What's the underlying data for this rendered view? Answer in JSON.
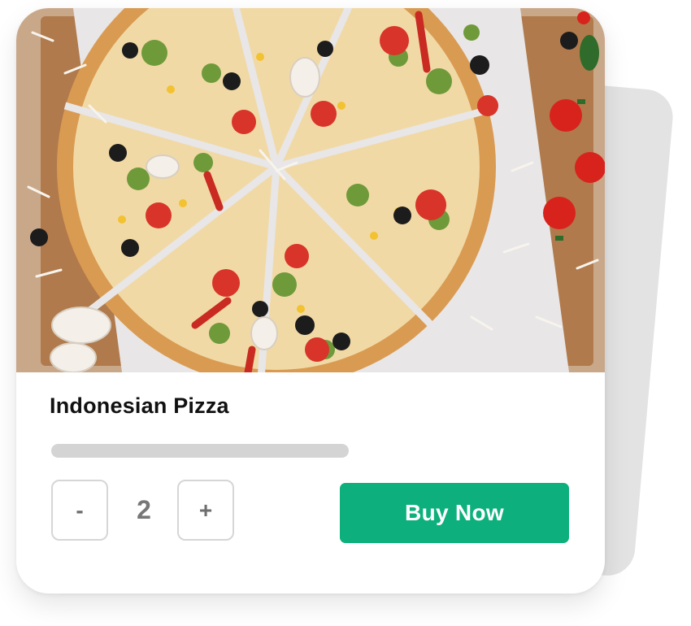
{
  "product": {
    "image_alt": "pizza-photo",
    "name": "Indonesian Pizza",
    "quantity": "2",
    "decrement_label": "-",
    "increment_label": "+",
    "buy_label": "Buy Now"
  },
  "colors": {
    "accent": "#0db07c",
    "bar": "#d4d4d4",
    "back_card": "#e3e3e3"
  }
}
